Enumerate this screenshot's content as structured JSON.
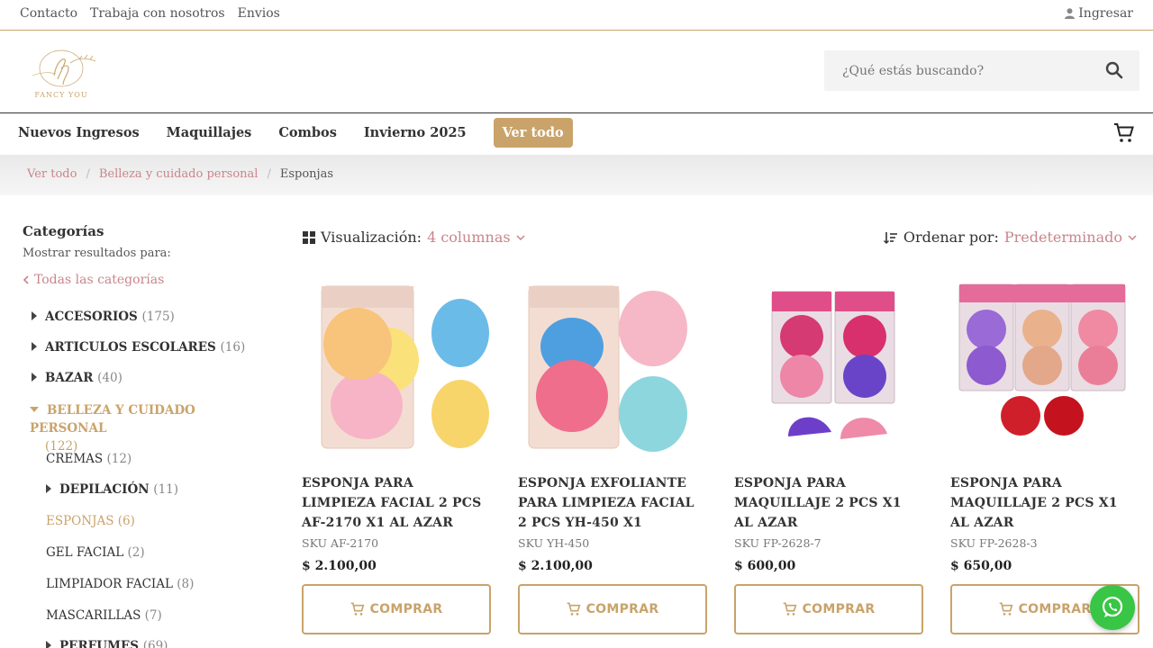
{
  "topbar": {
    "links": [
      "Contacto",
      "Trabaja con nosotros",
      "Envios"
    ],
    "login": "Ingresar"
  },
  "search": {
    "placeholder": "¿Qué estás buscando?"
  },
  "logo": {
    "text": "FANCY YOU"
  },
  "nav": {
    "items": [
      "Nuevos Ingresos",
      "Maquillajes",
      "Combos",
      "Invierno 2025",
      "Ver todo"
    ]
  },
  "breadcrumb": [
    "Ver todo",
    "Belleza y cuidado personal",
    "Esponjas"
  ],
  "sidebar": {
    "title": "Categorías",
    "results_for": "Mostrar resultados para:",
    "all": "Todas las categorías",
    "categories": [
      {
        "label": "ACCESORIOS",
        "count": "(175)"
      },
      {
        "label": "ARTICULOS ESCOLARES",
        "count": "(16)"
      },
      {
        "label": "BAZAR",
        "count": "(40)"
      },
      {
        "label": "BELLEZA Y CUIDADO PERSONAL",
        "count": "(122)"
      },
      {
        "label": "CREMAS",
        "count": "(12)"
      },
      {
        "label": "DEPILACIÓN",
        "count": "(11)"
      },
      {
        "label": "ESPONJAS",
        "count": "(6)"
      },
      {
        "label": "GEL FACIAL",
        "count": "(2)"
      },
      {
        "label": "LIMPIADOR FACIAL",
        "count": "(8)"
      },
      {
        "label": "MASCARILLAS",
        "count": "(7)"
      },
      {
        "label": "PERFUMES",
        "count": "(69)"
      }
    ]
  },
  "toolbar": {
    "view_label": "Visualización:",
    "view_value": "4 columnas",
    "sort_label": "Ordenar por:",
    "sort_value": "Predeterminado"
  },
  "products": [
    {
      "title": "ESPONJA PARA LIMPIEZA FACIAL 2 PCS AF-2170 X1 AL AZAR",
      "sku": "SKU AF-2170",
      "price": "$  2.100,00",
      "buy": "COMPRAR"
    },
    {
      "title": "ESPONJA EXFOLIANTE PARA LIMPIEZA FACIAL 2 PCS YH-450 X1",
      "sku": "SKU YH-450",
      "price": "$  2.100,00",
      "buy": "COMPRAR"
    },
    {
      "title": "ESPONJA PARA MAQUILLAJE 2 PCS X1 AL AZAR",
      "sku": "SKU FP-2628-7",
      "price": "$  600,00",
      "buy": "COMPRAR"
    },
    {
      "title": "ESPONJA PARA MAQUILLAJE 2 PCS X1 AL AZAR",
      "sku": "SKU FP-2628-3",
      "price": "$  650,00",
      "buy": "COMPRAR"
    }
  ],
  "colors": {
    "accent": "#c9a36a",
    "link": "#c9858b",
    "whatsapp": "#39c545"
  }
}
